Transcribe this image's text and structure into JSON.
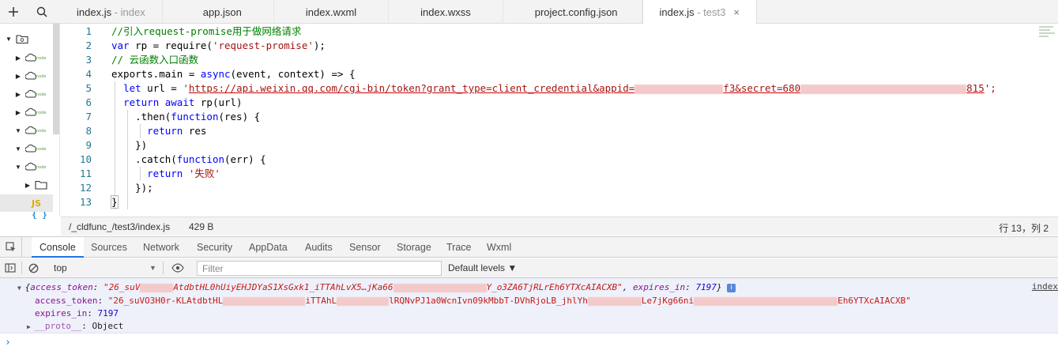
{
  "toolbar": {
    "add_icon": "plus-icon",
    "search_icon": "search-icon"
  },
  "tabs": [
    {
      "label": "index.js",
      "sub": " - index"
    },
    {
      "label": "app.json",
      "sub": ""
    },
    {
      "label": "index.wxml",
      "sub": ""
    },
    {
      "label": "index.wxss",
      "sub": ""
    },
    {
      "label": "project.config.json",
      "sub": ""
    },
    {
      "label": "index.js",
      "sub": " - test3",
      "close": "×"
    }
  ],
  "tree": {
    "js_label": "JS",
    "json_label": "{ }",
    "node_badge": "node"
  },
  "editor": {
    "line_numbers": [
      "1",
      "2",
      "3",
      "4",
      "5",
      "6",
      "7",
      "8",
      "9",
      "10",
      "11",
      "12",
      "13"
    ],
    "lines": {
      "l1": "//引入request-promise用于做网络请求",
      "l2_kw": "var",
      "l2_a": " rp = require(",
      "l2_str": "'request-promise'",
      "l2_b": ");",
      "l3": "// 云函数入口函数",
      "l4_a": "exports.main = ",
      "l4_kw": "async",
      "l4_b": "(event, context) => {",
      "l5_kw": "let",
      "l5_a": " url = ",
      "l5_q": "'",
      "l5_url1": "https://api.weixin.qq.com/cgi-bin/token?grant_type=client_credential&appid=",
      "l5_url2": "f3&secret=680",
      "l5_url3": "815",
      "l5_end": "';",
      "l6_kw": "return",
      "l6_kw2": " await",
      "l6_a": " rp(url)",
      "l7_a": ".then(",
      "l7_kw": "function",
      "l7_b": "(res) {",
      "l8_kw": "return",
      "l8_a": " res",
      "l9": "})",
      "l10_a": ".catch(",
      "l10_kw": "function",
      "l10_b": "(err) {",
      "l11_kw": "return",
      "l11_str": " '失败'",
      "l12": "});",
      "l13": "}"
    }
  },
  "status": {
    "path": "/_cldfunc_/test3/index.js",
    "size": "429 B",
    "position": "行 13，列 2"
  },
  "devtools": {
    "tabs": [
      "Console",
      "Sources",
      "Network",
      "Security",
      "AppData",
      "Audits",
      "Sensor",
      "Storage",
      "Trace",
      "Wxml"
    ],
    "context": "top",
    "filter_placeholder": "Filter",
    "levels": "Default levels ▼"
  },
  "console": {
    "summary": {
      "open": "{",
      "k1": "access_token",
      "v1a": "\"26_suV",
      "v1b": "AtdbtHL0hUiyEHJDYaS1XsGxk1_iTTAhLvX5…jKa66",
      "v1c": "Y_o3ZA6TjRLrEh6YTXcAIACXB\"",
      "sep": ", ",
      "k2": "expires_in",
      "v2": "7197",
      "close": "}",
      "badge": "i"
    },
    "token_row": {
      "key": "access_token",
      "v1": "\"26_suVO3H0r-KLAtdbtHL",
      "v2": "iTTAhL",
      "v3": "lRQNvPJ1a0WcnIvn09kMbbT-DVhRjoLB_jhlYh",
      "v4": "Le7jKg66ni",
      "v5": "Eh6YTXcAIACXB\""
    },
    "expires_row": {
      "key": "expires_in",
      "value": "7197"
    },
    "proto_row": {
      "key": "__proto__",
      "value": "Object"
    },
    "source_link": "index",
    "prompt": "›"
  },
  "colors": {
    "accent": "#1a73e8",
    "comment": "#008000",
    "keyword": "#0000ff",
    "string": "#a31515"
  }
}
